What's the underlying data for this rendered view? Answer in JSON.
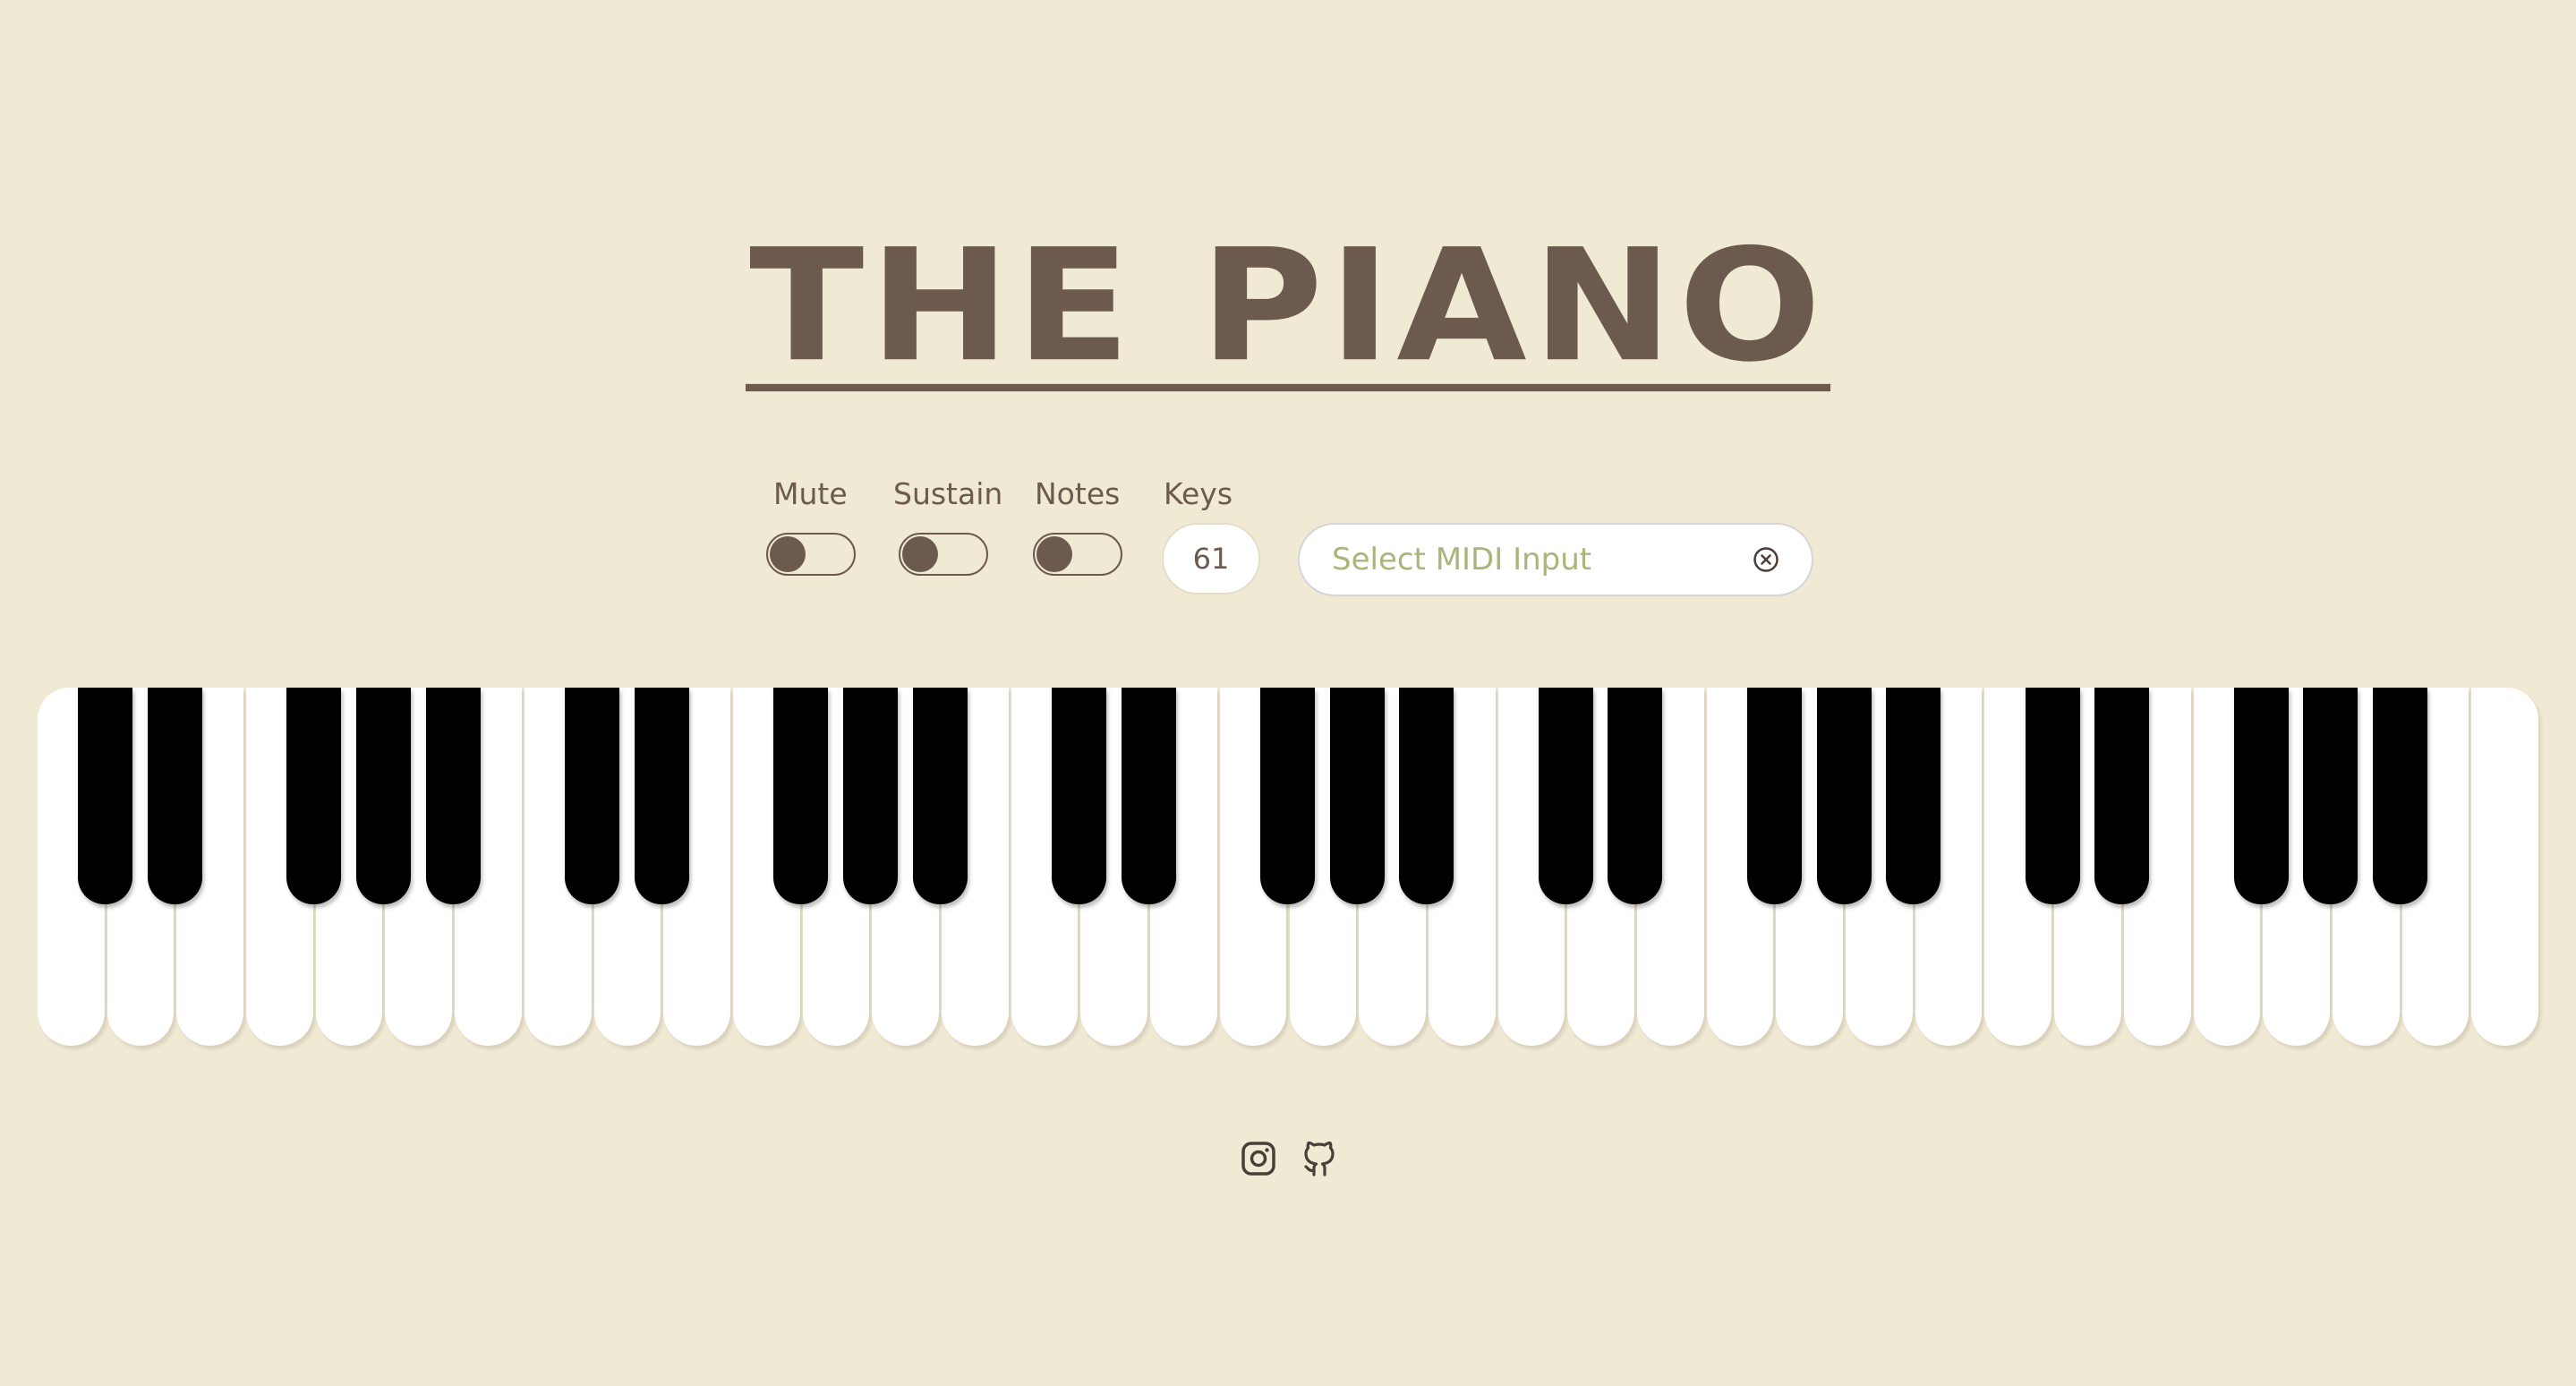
{
  "header": {
    "title": "THE PIANO"
  },
  "controls": {
    "mute_label": "Mute",
    "sustain_label": "Sustain",
    "notes_label": "Notes",
    "keys_label": "Keys",
    "keys_value": "61",
    "mute_on": false,
    "sustain_on": false,
    "notes_on": false,
    "midi_placeholder": "Select MIDI Input",
    "midi_clear_icon": "circle-x-icon"
  },
  "piano": {
    "key_count": 61,
    "white_key_count": 36,
    "black_key_count": 25,
    "white_color": "#ffffff",
    "black_color": "#000000"
  },
  "social": {
    "icons": [
      "instagram-icon",
      "github-icon"
    ]
  },
  "colors": {
    "background": "#f0ead5",
    "text": "#6b5a4d",
    "midi_placeholder": "#a8b67a"
  }
}
